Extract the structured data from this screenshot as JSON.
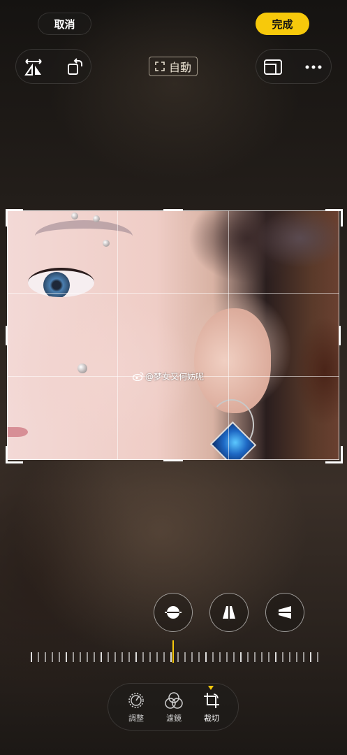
{
  "header": {
    "cancel_label": "取消",
    "done_label": "完成",
    "auto_label": "自動"
  },
  "toolbar_left": {
    "icons": [
      "flip-horizontal-icon",
      "rotate-icon"
    ]
  },
  "toolbar_right": {
    "icons": [
      "aspect-ratio-icon",
      "more-icon"
    ]
  },
  "photo": {
    "watermark": "@梦女又何妨呢"
  },
  "adjust_buttons": [
    "straighten-icon",
    "vertical-perspective-icon",
    "horizontal-perspective-icon"
  ],
  "tabs": [
    {
      "label": "調整",
      "icon": "adjust-dial-icon"
    },
    {
      "label": "濾鏡",
      "icon": "filters-icon"
    },
    {
      "label": "裁切",
      "icon": "crop-icon",
      "active": true
    }
  ],
  "colors": {
    "accent": "#f7c90b"
  }
}
